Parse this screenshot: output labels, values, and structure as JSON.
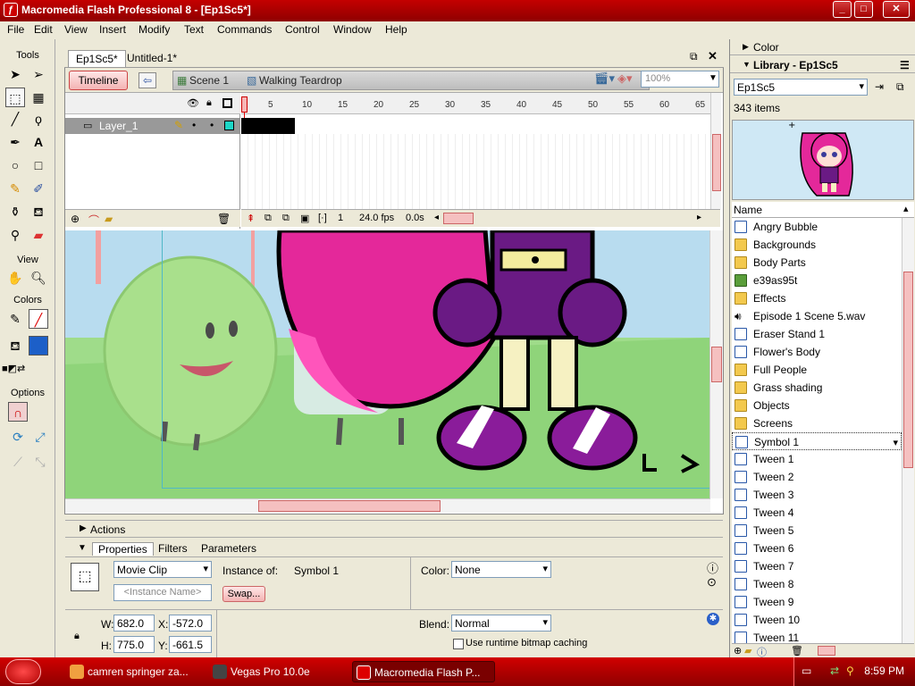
{
  "titlebar": {
    "title": "Macromedia Flash Professional 8 - [Ep1Sc5*]"
  },
  "menu": [
    "File",
    "Edit",
    "View",
    "Insert",
    "Modify",
    "Text",
    "Commands",
    "Control",
    "Window",
    "Help"
  ],
  "tools": {
    "tools_label": "Tools",
    "view_label": "View",
    "colors_label": "Colors",
    "options_label": "Options"
  },
  "document": {
    "tabs": [
      "Ep1Sc5*",
      "Untitled-1*"
    ],
    "timeline_button": "Timeline",
    "scene": "Scene 1",
    "symbol": "Walking Teardrop",
    "zoom": "100%"
  },
  "timeline": {
    "layer_name": "Layer_1",
    "ruler": [
      "1",
      "5",
      "10",
      "15",
      "20",
      "25",
      "30",
      "35",
      "40",
      "45",
      "50",
      "55",
      "60",
      "65"
    ],
    "current_frame": "1",
    "fps": "24.0 fps",
    "time": "0.0s"
  },
  "panels": {
    "actions": "Actions",
    "tabs": [
      "Properties",
      "Filters",
      "Parameters"
    ]
  },
  "properties": {
    "type": "Movie Clip",
    "instance_name_placeholder": "<Instance Name>",
    "instance_of_label": "Instance of:",
    "instance_of": "Symbol 1",
    "swap": "Swap...",
    "color_label": "Color:",
    "color": "None",
    "w_label": "W:",
    "w": "682.0",
    "h_label": "H:",
    "h": "775.0",
    "x_label": "X:",
    "x": "-572.0",
    "y_label": "Y:",
    "y": "-661.5",
    "blend_label": "Blend:",
    "blend": "Normal",
    "cache_label": "Use runtime bitmap caching"
  },
  "right": {
    "color_panel": "Color",
    "library_panel": "Library - Ep1Sc5",
    "library_select": "Ep1Sc5",
    "count": "343 items",
    "name_col": "Name",
    "items": [
      {
        "name": "Angry Bubble",
        "type": "sym"
      },
      {
        "name": "Backgrounds",
        "type": "folder"
      },
      {
        "name": "Body Parts",
        "type": "folder"
      },
      {
        "name": "e39as95t",
        "type": "bmp"
      },
      {
        "name": "Effects",
        "type": "folder"
      },
      {
        "name": "Episode 1 Scene 5.wav",
        "type": "snd"
      },
      {
        "name": "Eraser Stand 1",
        "type": "sym"
      },
      {
        "name": "Flower's Body",
        "type": "sym"
      },
      {
        "name": "Full People",
        "type": "folder"
      },
      {
        "name": "Grass shading",
        "type": "folder"
      },
      {
        "name": "Objects",
        "type": "folder"
      },
      {
        "name": "Screens",
        "type": "folder"
      },
      {
        "name": "Symbol 1",
        "type": "sym",
        "selected": true
      },
      {
        "name": "Tween 1",
        "type": "sym"
      },
      {
        "name": "Tween 2",
        "type": "sym"
      },
      {
        "name": "Tween 3",
        "type": "sym"
      },
      {
        "name": "Tween 4",
        "type": "sym"
      },
      {
        "name": "Tween 5",
        "type": "sym"
      },
      {
        "name": "Tween 6",
        "type": "sym"
      },
      {
        "name": "Tween 7",
        "type": "sym"
      },
      {
        "name": "Tween 8",
        "type": "sym"
      },
      {
        "name": "Tween 9",
        "type": "sym"
      },
      {
        "name": "Tween 10",
        "type": "sym"
      },
      {
        "name": "Tween 11",
        "type": "sym"
      }
    ]
  },
  "taskbar": {
    "tasks": [
      "camren springer za...",
      "Vegas Pro 10.0e",
      "Macromedia Flash P..."
    ],
    "clock": "8:59 PM"
  }
}
